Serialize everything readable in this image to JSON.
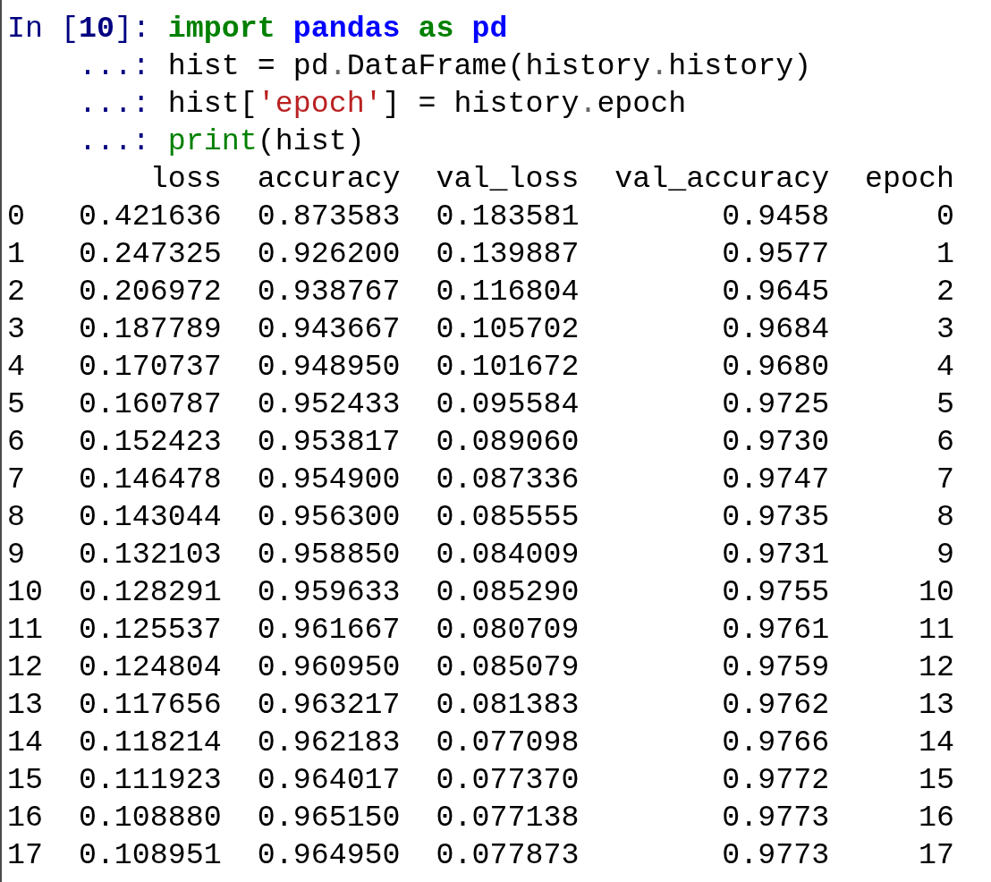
{
  "input": {
    "prompt": "In [**10**]:",
    "continuation": "...:",
    "lines": [
      [
        {
          "kind": "keyword",
          "text": "import"
        },
        {
          "kind": "module",
          "text": " pandas"
        },
        {
          "kind": "keyword",
          "text": " as"
        },
        {
          "kind": "module",
          "text": " pd"
        }
      ],
      [
        {
          "kind": "plain",
          "text": "hist = pd"
        },
        {
          "kind": "operator",
          "text": "."
        },
        {
          "kind": "plain",
          "text": "DataFrame(history"
        },
        {
          "kind": "operator",
          "text": "."
        },
        {
          "kind": "plain",
          "text": "history)"
        }
      ],
      [
        {
          "kind": "plain",
          "text": "hist["
        },
        {
          "kind": "string",
          "text": "'epoch'"
        },
        {
          "kind": "plain",
          "text": "] = history"
        },
        {
          "kind": "operator",
          "text": "."
        },
        {
          "kind": "plain",
          "text": "epoch"
        }
      ],
      [
        {
          "kind": "builtin",
          "text": "print"
        },
        {
          "kind": "plain",
          "text": "(hist)"
        }
      ]
    ]
  },
  "output": {
    "columns": [
      "loss",
      "accuracy",
      "val_loss",
      "val_accuracy",
      "epoch"
    ],
    "rows": [
      {
        "index": "0",
        "cells": [
          "0.421636",
          "0.873583",
          "0.183581",
          "0.9458",
          "0"
        ]
      },
      {
        "index": "1",
        "cells": [
          "0.247325",
          "0.926200",
          "0.139887",
          "0.9577",
          "1"
        ]
      },
      {
        "index": "2",
        "cells": [
          "0.206972",
          "0.938767",
          "0.116804",
          "0.9645",
          "2"
        ]
      },
      {
        "index": "3",
        "cells": [
          "0.187789",
          "0.943667",
          "0.105702",
          "0.9684",
          "3"
        ]
      },
      {
        "index": "4",
        "cells": [
          "0.170737",
          "0.948950",
          "0.101672",
          "0.9680",
          "4"
        ]
      },
      {
        "index": "5",
        "cells": [
          "0.160787",
          "0.952433",
          "0.095584",
          "0.9725",
          "5"
        ]
      },
      {
        "index": "6",
        "cells": [
          "0.152423",
          "0.953817",
          "0.089060",
          "0.9730",
          "6"
        ]
      },
      {
        "index": "7",
        "cells": [
          "0.146478",
          "0.954900",
          "0.087336",
          "0.9747",
          "7"
        ]
      },
      {
        "index": "8",
        "cells": [
          "0.143044",
          "0.956300",
          "0.085555",
          "0.9735",
          "8"
        ]
      },
      {
        "index": "9",
        "cells": [
          "0.132103",
          "0.958850",
          "0.084009",
          "0.9731",
          "9"
        ]
      },
      {
        "index": "10",
        "cells": [
          "0.128291",
          "0.959633",
          "0.085290",
          "0.9755",
          "10"
        ]
      },
      {
        "index": "11",
        "cells": [
          "0.125537",
          "0.961667",
          "0.080709",
          "0.9761",
          "11"
        ]
      },
      {
        "index": "12",
        "cells": [
          "0.124804",
          "0.960950",
          "0.085079",
          "0.9759",
          "12"
        ]
      },
      {
        "index": "13",
        "cells": [
          "0.117656",
          "0.963217",
          "0.081383",
          "0.9762",
          "13"
        ]
      },
      {
        "index": "14",
        "cells": [
          "0.118214",
          "0.962183",
          "0.077098",
          "0.9766",
          "14"
        ]
      },
      {
        "index": "15",
        "cells": [
          "0.111923",
          "0.964017",
          "0.077370",
          "0.9772",
          "15"
        ]
      },
      {
        "index": "16",
        "cells": [
          "0.108880",
          "0.965150",
          "0.077138",
          "0.9773",
          "16"
        ]
      },
      {
        "index": "17",
        "cells": [
          "0.108951",
          "0.964950",
          "0.077873",
          "0.9773",
          "17"
        ]
      }
    ]
  }
}
